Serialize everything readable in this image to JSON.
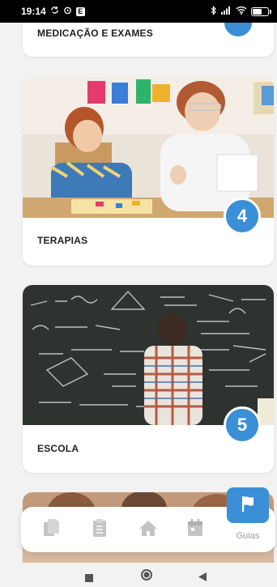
{
  "status_bar": {
    "time": "19:14",
    "left_icons": [
      "sync-icon",
      "alarm-icon",
      "notification-box-icon"
    ],
    "right_icons": [
      "bluetooth-icon",
      "signal-icon",
      "wifi-icon",
      "battery-icon"
    ],
    "notification_letter": "E"
  },
  "cards": [
    {
      "title": "MEDICAÇÃO E EXAMES"
    },
    {
      "title": "TERAPIAS",
      "number": "4",
      "image": "child-therapy-photo"
    },
    {
      "title": "ESCOLA",
      "number": "5",
      "image": "chalkboard-student-photo"
    },
    {
      "title": "",
      "image": "group-photo"
    }
  ],
  "bottom_nav": {
    "items": [
      {
        "icon": "documents-icon"
      },
      {
        "icon": "clipboard-icon"
      },
      {
        "icon": "home-icon"
      },
      {
        "icon": "calendar-icon"
      },
      {
        "icon": "flag-icon",
        "label": "Guias",
        "active": true
      }
    ]
  },
  "colors": {
    "accent": "#3a8fd6",
    "background": "#f2f2f2",
    "card": "#ffffff",
    "nav_icon": "#c4c4c4",
    "nav_label": "#9a9a9a"
  }
}
